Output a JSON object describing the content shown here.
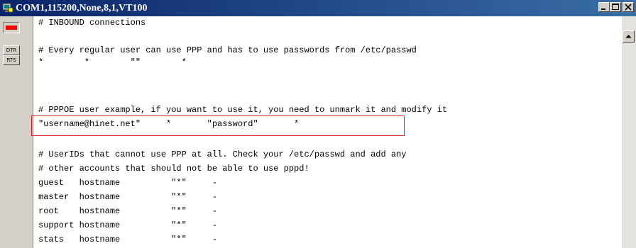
{
  "window": {
    "title": "COM1,115200,None,8,1,VT100",
    "minimize_icon": "minimize-icon",
    "maximize_icon": "maximize-icon",
    "close_icon": "close-icon"
  },
  "left_panel": {
    "status_led_color": "#ff0000",
    "buttons": [
      {
        "label": "DTR"
      },
      {
        "label": "RTS"
      }
    ]
  },
  "terminal": {
    "lines": [
      "# INBOUND connections",
      "",
      "# Every regular user can use PPP and has to use passwords from /etc/passwd",
      "*        *        \"\"        *",
      "",
      "# PPPOE user example, if you want to use it, you need to unmark it and modify it",
      "\"username@hinet.net\"     *       \"password\"       *",
      "",
      "# UserIDs that cannot use PPP at all. Check your /etc/passwd and add any",
      "# other accounts that should not be able to use pppd!",
      "guest   hostname          \"*\"     -",
      "master  hostname          \"*\"     -",
      "root    hostname          \"*\"     -",
      "support hostname          \"*\"     -",
      "stats   hostname          \"*\"     -"
    ],
    "highlight_color": "#e02020"
  },
  "scrollbar": {
    "up_icon": "arrow-up-icon"
  }
}
